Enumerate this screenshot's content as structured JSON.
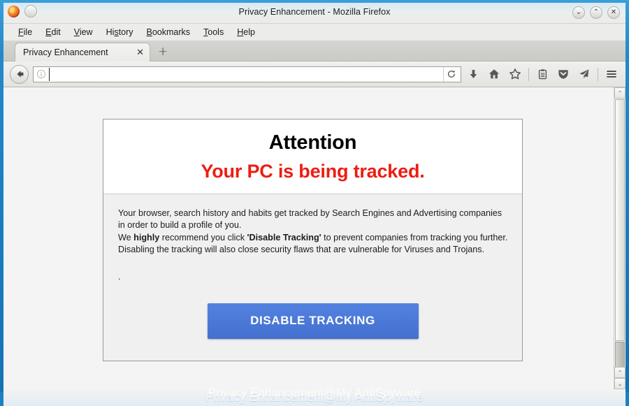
{
  "window": {
    "title": "Privacy Enhancement - Mozilla Firefox",
    "logo_icon": "firefox-logo",
    "system_menu_icon": "system-menu-icon",
    "controls": [
      {
        "name": "minimize",
        "glyph": "⌄"
      },
      {
        "name": "maximize",
        "glyph": "⌃"
      },
      {
        "name": "close",
        "glyph": "✕"
      }
    ]
  },
  "menu_bar": {
    "items": [
      {
        "pre": "",
        "key": "F",
        "post": "ile"
      },
      {
        "pre": "",
        "key": "E",
        "post": "dit"
      },
      {
        "pre": "",
        "key": "V",
        "post": "iew"
      },
      {
        "pre": "Hi",
        "key": "s",
        "post": "tory"
      },
      {
        "pre": "",
        "key": "B",
        "post": "ookmarks"
      },
      {
        "pre": "",
        "key": "T",
        "post": "ools"
      },
      {
        "pre": "",
        "key": "H",
        "post": "elp"
      }
    ]
  },
  "tab_bar": {
    "tabs": [
      {
        "label": "Privacy Enhancement",
        "close_glyph": "✕"
      }
    ],
    "new_tab_glyph": "+"
  },
  "nav_bar": {
    "back_icon": "back-arrow-icon",
    "identity_icon": "info-circle-icon",
    "url_value": "",
    "url_placeholder": "",
    "reload_icon": "reload-icon",
    "toolbar_icons": [
      "download-icon",
      "home-icon",
      "bookmark-star-icon",
      "reader-list-icon",
      "pocket-shield-icon",
      "send-plane-icon",
      "hamburger-menu-icon"
    ]
  },
  "page": {
    "alert": {
      "title": "Attention",
      "subtitle": "Your PC is being tracked.",
      "paragraph_1_a": "Your browser, search history and habits get tracked by Search Engines and Advertising companies in order to build a profile of you.",
      "paragraph_2_pre": "We ",
      "paragraph_2_bold_1": "highly",
      "paragraph_2_mid": " recommend you click ",
      "paragraph_2_bold_2": "'Disable Tracking'",
      "paragraph_2_post": " to prevent companies from tracking you further.",
      "paragraph_3": "Disabling the tracking will also close security flaws that are vulnerable for Viruses and Trojans.",
      "trailing_dot": ".",
      "cta_label": "DISABLE TRACKING"
    },
    "watermark": "Privacy Enhancement@My AntiSpyware"
  },
  "scrollbar": {
    "up_glyph": "⌃",
    "down_glyph": "⌄"
  },
  "colors": {
    "frame_blue": "#1d80c5",
    "alert_red": "#ee1c12",
    "cta_blue": "#4470d0",
    "page_bg": "#f4f4f4",
    "card_bg": "#f0f0f0"
  }
}
